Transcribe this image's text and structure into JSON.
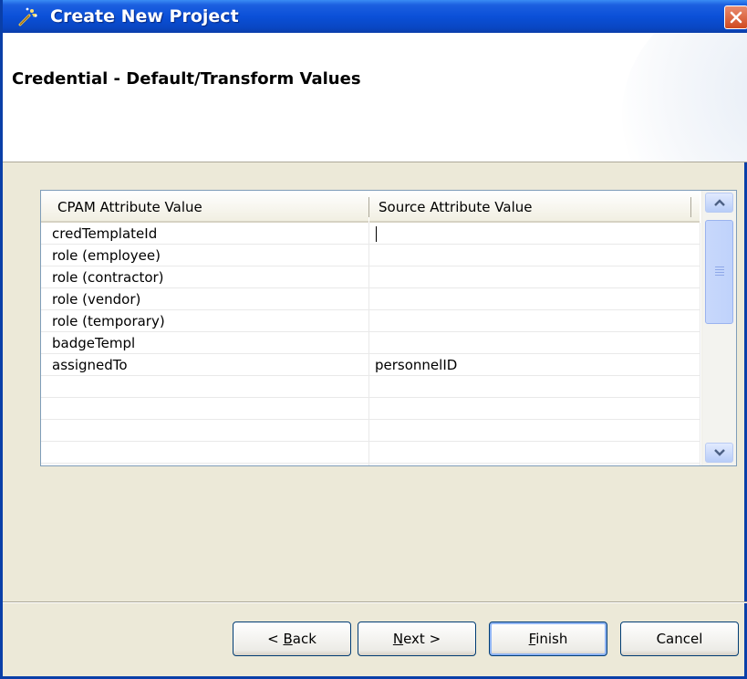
{
  "window": {
    "title": "Create New Project",
    "icon": "wizard-icon",
    "close_icon": "close-icon"
  },
  "header": {
    "title": "Credential - Default/Transform Values"
  },
  "table": {
    "columns": [
      "CPAM Attribute Value",
      "Source Attribute Value"
    ],
    "rows": [
      {
        "cpam": "credTemplateId",
        "source": ""
      },
      {
        "cpam": "role (employee)",
        "source": ""
      },
      {
        "cpam": "role (contractor)",
        "source": ""
      },
      {
        "cpam": "role (vendor)",
        "source": ""
      },
      {
        "cpam": "role (temporary)",
        "source": ""
      },
      {
        "cpam": "badgeTempl",
        "source": ""
      },
      {
        "cpam": "assignedTo",
        "source": "personnelID"
      },
      {
        "cpam": "",
        "source": ""
      },
      {
        "cpam": "",
        "source": ""
      },
      {
        "cpam": "",
        "source": ""
      },
      {
        "cpam": "",
        "source": ""
      }
    ]
  },
  "buttons": {
    "back": {
      "pre": "< ",
      "accel": "B",
      "post": "ack"
    },
    "next": {
      "pre": "",
      "accel": "N",
      "post": "ext >"
    },
    "finish": {
      "pre": "",
      "accel": "F",
      "post": "inish"
    },
    "cancel": {
      "pre": "",
      "accel": "",
      "post": "Cancel"
    }
  },
  "colors": {
    "titlebar": "#0b50d8",
    "dialog_bg": "#ece9d8",
    "button_border": "#003c74"
  }
}
